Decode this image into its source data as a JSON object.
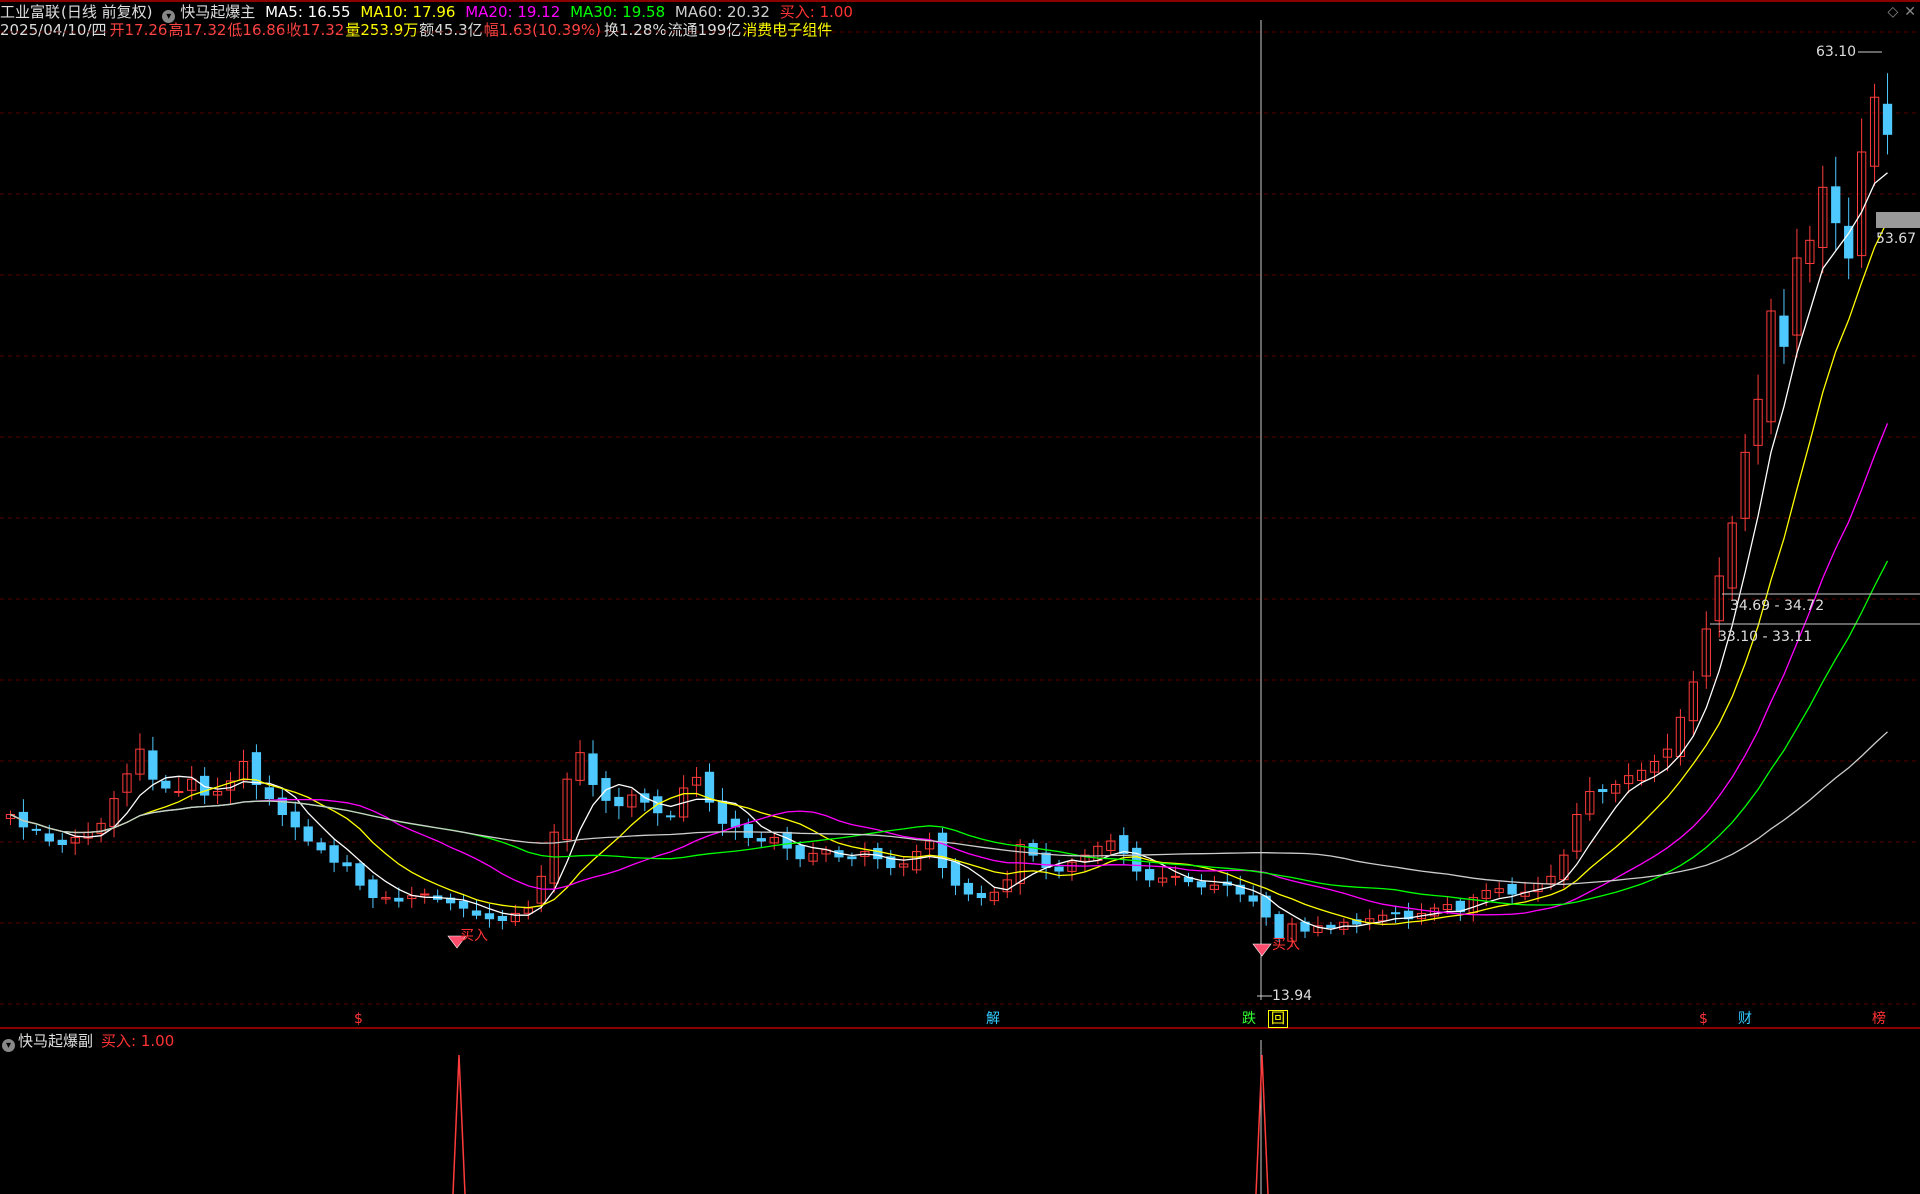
{
  "header": {
    "stock_name": "工业富联",
    "period": "(日线 前复权)",
    "indicator_name": "快马起爆主",
    "ma": [
      {
        "label": "MA5: 16.55",
        "color": "#ffffff"
      },
      {
        "label": "MA10: 17.96",
        "color": "#ffff00"
      },
      {
        "label": "MA20: 19.12",
        "color": "#ff00ff"
      },
      {
        "label": "MA30: 19.58",
        "color": "#00ff00"
      },
      {
        "label": "MA60: 20.32",
        "color": "#cccccc"
      }
    ],
    "signal": "买入: 1.00"
  },
  "quote_line": {
    "date": "2025/04/10/四",
    "open": "开17.26",
    "high": "高17.32",
    "low": "低16.86",
    "close": "收17.32",
    "volume": "量253.9万",
    "amount": "额45.3亿",
    "change": "幅1.63(10.39%)",
    "turnover": "换1.28%",
    "float_cap": "流通199亿",
    "sector": "消费电子组件"
  },
  "annotations": {
    "high_label": "63.10",
    "low_label": "13.94",
    "price_tag": "53.67",
    "range1": "34.69 - 34.72",
    "range2": "33.10 - 33.11",
    "buy_label_1": "买入",
    "buy_label_2": "买入"
  },
  "events": [
    {
      "text": "$",
      "color": "#ff3333"
    },
    {
      "text": "解",
      "color": "#33ccff"
    },
    {
      "text": "跌",
      "color": "#33ff33"
    },
    {
      "text": "回",
      "color": "#ffff00"
    },
    {
      "text": "$",
      "color": "#ff3333"
    },
    {
      "text": "财",
      "color": "#33ccff"
    },
    {
      "text": "榜",
      "color": "#ff3333"
    }
  ],
  "sub_panel": {
    "indicator_name": "快马起爆副",
    "signal": "买入: 1.00"
  },
  "icons": [
    "diamond-icon",
    "close-icon"
  ],
  "colors": {
    "up": "#ff3b3b",
    "down": "#4ec9ff",
    "ma5": "#ffffff",
    "ma10": "#ffff00",
    "ma20": "#ff00ff",
    "ma30": "#00ff00",
    "ma60": "#cccccc",
    "grid": "#5a0000"
  },
  "chart_data": {
    "type": "candlestick",
    "price_range": [
      12,
      66
    ],
    "approx_closes": [
      22.5,
      21.8,
      21.6,
      21.0,
      20.8,
      21.2,
      21.5,
      22.0,
      23.4,
      24.8,
      26.2,
      24.5,
      24.0,
      23.8,
      24.5,
      23.6,
      23.8,
      24.4,
      25.5,
      24.2,
      23.4,
      22.5,
      21.8,
      21.0,
      20.5,
      19.8,
      19.6,
      18.5,
      17.8,
      17.8,
      17.6,
      17.9,
      18.0,
      17.7,
      17.5,
      17.2,
      16.8,
      16.6,
      16.5,
      16.9,
      17.2,
      19.0,
      21.5,
      24.5,
      26.0,
      24.2,
      23.3,
      23.0,
      23.6,
      23.2,
      22.6,
      22.4,
      24.0,
      24.6,
      23.2,
      22.0,
      21.8,
      21.2,
      21.0,
      21.2,
      20.6,
      20.0,
      20.3,
      20.5,
      20.1,
      20.0,
      20.4,
      20.0,
      19.5,
      19.7,
      20.4,
      21.0,
      19.5,
      18.5,
      18.0,
      17.8,
      18.1,
      18.8,
      20.8,
      20.2,
      19.5,
      19.3,
      19.8,
      20.2,
      20.7,
      21.0,
      20.3,
      19.3,
      18.8,
      18.9,
      19.0,
      18.7,
      18.4,
      18.5,
      18.5,
      18.0,
      17.6,
      16.7,
      15.5,
      16.3,
      15.9,
      16.2,
      16.1,
      16.4,
      16.3,
      16.6,
      16.8,
      16.9,
      16.6,
      16.9,
      17.2,
      17.4,
      17.0,
      17.8,
      18.2,
      18.3,
      18.0,
      18.1,
      18.6,
      19.0,
      20.2,
      22.5,
      23.8,
      23.8,
      24.2,
      24.7,
      25.0,
      25.5,
      26.2,
      28.0,
      30.0,
      33.0,
      36.0,
      39.0,
      43.0,
      46.0,
      51.0,
      49.0,
      54.0,
      55.0,
      58.0,
      56.0,
      54.0,
      60.0,
      63.1,
      61.0
    ]
  }
}
